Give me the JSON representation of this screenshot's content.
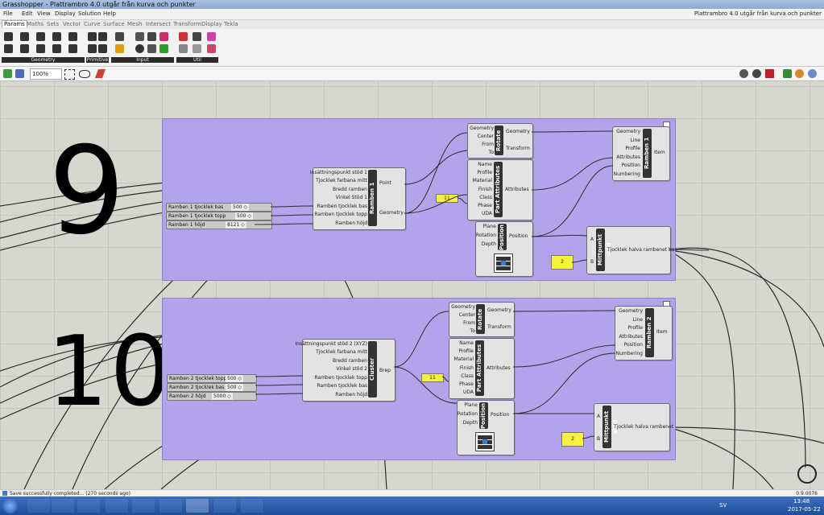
{
  "window": {
    "title": "Grasshopper - Plattrambro 4.0 utgår från kurva och punkter",
    "doc_name": "Plattrambro 4.0 utgår från kurva och punkter"
  },
  "menu": [
    "File",
    "Edit",
    "View",
    "Display",
    "Solution",
    "Help"
  ],
  "tabs": [
    "Params",
    "Maths",
    "Sets",
    "Vector",
    "Curve",
    "Surface",
    "Mesh",
    "Intersect",
    "Transform",
    "Display",
    "Tekla"
  ],
  "ribbon_groups": [
    "Geometry",
    "Primitive",
    "Input",
    "Util"
  ],
  "canvas_toolbar": {
    "zoom": "100%"
  },
  "annotations": {
    "top": "9",
    "bottom": "10"
  },
  "group1": {
    "sliders": [
      {
        "label": "Ramben 1 tjocklek bas",
        "value": "500 ◇"
      },
      {
        "label": "Ramben 1 tjocklek topp",
        "value": "500 ◇"
      },
      {
        "label": "Ramben 1 höjd",
        "value": "8121 ◇"
      }
    ],
    "cluster": {
      "title": "Ramben 1",
      "inputs": [
        "Insättningspunkt stöd 1",
        "Tjocklek farbana mitt",
        "Bredd ramben",
        "Vinkel Stöd 1",
        "Ramben tjocklek bas",
        "Ramben tjocklek topp",
        "Ramben höjd"
      ],
      "outputs": [
        "Point",
        "Geometry"
      ]
    },
    "rotate": {
      "title": "Rotate",
      "inputs": [
        "Geometry",
        "Center",
        "From",
        "To"
      ],
      "outputs": [
        "Geometry",
        "Transform"
      ]
    },
    "part_attributes": {
      "title": "Part Attributes",
      "inputs": [
        "Name",
        "Profile",
        "Material",
        "Finish",
        "Class",
        "Phase",
        "UDA"
      ],
      "outputs": [
        "Attributes"
      ]
    },
    "position": {
      "title": "Position",
      "inputs": [
        "Plane",
        "Rotation",
        "Depth"
      ],
      "outputs": [
        "Position"
      ]
    },
    "beam": {
      "title": "Ramben 1",
      "inputs": [
        "Geometry",
        "Line",
        "Profile",
        "Attributes",
        "Position",
        "Numbering"
      ],
      "outputs": [
        "Item"
      ]
    },
    "midpoint": {
      "title": "Mittpunkt stöd",
      "inputs": [
        "A",
        "B"
      ],
      "outputs": [
        "Tjocklek halva rambenet bas"
      ]
    },
    "panel_class": "11",
    "panel_b": "2"
  },
  "group2": {
    "sliders": [
      {
        "label": "Ramben 2 tjocklek topp",
        "value": "500 ◇"
      },
      {
        "label": "Ramben 2 tjocklek bas",
        "value": "500 ◇"
      },
      {
        "label": "Ramben 2 höjd",
        "value": "5000 ◇"
      }
    ],
    "cluster": {
      "title": "Cluster",
      "inputs": [
        "Insättningspunkt stöd 2 (XYZ)",
        "Tjocklek farbana mitt",
        "Bredd ramben",
        "Vinkel stöd 2",
        "Ramben tjocklek topp",
        "Ramben tjocklek bas",
        "Ramben höjd"
      ],
      "outputs": [
        "Brep"
      ]
    },
    "rotate": {
      "title": "Rotate",
      "inputs": [
        "Geometry",
        "Center",
        "From",
        "To"
      ],
      "outputs": [
        "Geometry",
        "Transform"
      ]
    },
    "part_attributes": {
      "title": "Part Attributes",
      "inputs": [
        "Name",
        "Profile",
        "Material",
        "Finish",
        "Class",
        "Phase",
        "UDA"
      ],
      "outputs": [
        "Attributes"
      ]
    },
    "position": {
      "title": "Position",
      "inputs": [
        "Plane",
        "Rotation",
        "Depth"
      ],
      "outputs": [
        "Position"
      ]
    },
    "beam": {
      "title": "Ramben 2",
      "inputs": [
        "Geometry",
        "Line",
        "Profile",
        "Attributes",
        "Position",
        "Numbering"
      ],
      "outputs": [
        "Item"
      ]
    },
    "midpoint": {
      "title": "Mittpunkt stöd",
      "inputs": [
        "A",
        "B"
      ],
      "outputs": [
        "Tjocklek halva rambenet"
      ]
    },
    "panel_class": "11",
    "panel_b": "2"
  },
  "status": {
    "message": "Save successfully completed... (270 seconds ago)",
    "version": "0.9.0076"
  },
  "taskbar": {
    "lang": "SV",
    "time": "13:48",
    "date": "2017-05-22"
  },
  "colors": {
    "group": "#b2a3ea",
    "canvas": "#d8d7cf",
    "panel": "#f6f23c",
    "taskbar": "#2a5aa8"
  }
}
